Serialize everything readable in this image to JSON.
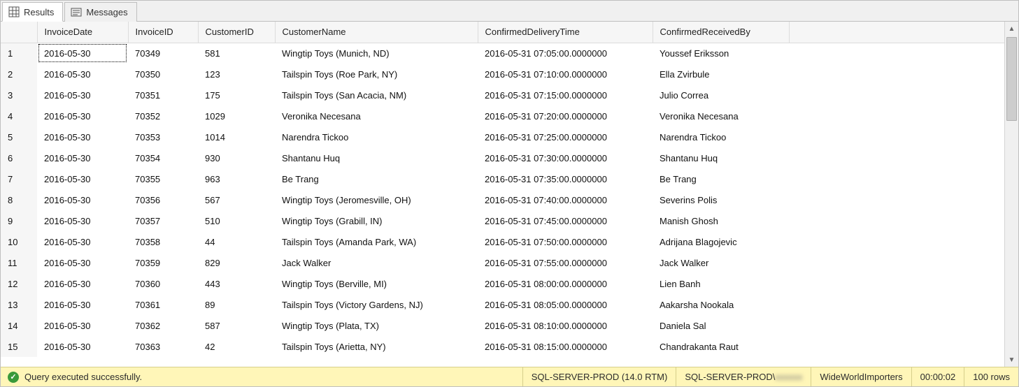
{
  "tabs": {
    "results": "Results",
    "messages": "Messages"
  },
  "columns": {
    "invoiceDate": "InvoiceDate",
    "invoiceId": "InvoiceID",
    "customerId": "CustomerID",
    "customerName": "CustomerName",
    "confirmedDeliveryTime": "ConfirmedDeliveryTime",
    "confirmedReceivedBy": "ConfirmedReceivedBy"
  },
  "rows": [
    {
      "n": "1",
      "invoiceDate": "2016-05-30",
      "invoiceId": "70349",
      "customerId": "581",
      "customerName": "Wingtip Toys (Munich, ND)",
      "confirmedDeliveryTime": "2016-05-31 07:05:00.0000000",
      "confirmedReceivedBy": "Youssef Eriksson"
    },
    {
      "n": "2",
      "invoiceDate": "2016-05-30",
      "invoiceId": "70350",
      "customerId": "123",
      "customerName": "Tailspin Toys (Roe Park, NY)",
      "confirmedDeliveryTime": "2016-05-31 07:10:00.0000000",
      "confirmedReceivedBy": "Ella Zvirbule"
    },
    {
      "n": "3",
      "invoiceDate": "2016-05-30",
      "invoiceId": "70351",
      "customerId": "175",
      "customerName": "Tailspin Toys (San Acacia, NM)",
      "confirmedDeliveryTime": "2016-05-31 07:15:00.0000000",
      "confirmedReceivedBy": "Julio Correa"
    },
    {
      "n": "4",
      "invoiceDate": "2016-05-30",
      "invoiceId": "70352",
      "customerId": "1029",
      "customerName": "Veronika Necesana",
      "confirmedDeliveryTime": "2016-05-31 07:20:00.0000000",
      "confirmedReceivedBy": "Veronika Necesana"
    },
    {
      "n": "5",
      "invoiceDate": "2016-05-30",
      "invoiceId": "70353",
      "customerId": "1014",
      "customerName": "Narendra Tickoo",
      "confirmedDeliveryTime": "2016-05-31 07:25:00.0000000",
      "confirmedReceivedBy": "Narendra Tickoo"
    },
    {
      "n": "6",
      "invoiceDate": "2016-05-30",
      "invoiceId": "70354",
      "customerId": "930",
      "customerName": "Shantanu Huq",
      "confirmedDeliveryTime": "2016-05-31 07:30:00.0000000",
      "confirmedReceivedBy": "Shantanu Huq"
    },
    {
      "n": "7",
      "invoiceDate": "2016-05-30",
      "invoiceId": "70355",
      "customerId": "963",
      "customerName": "Be Trang",
      "confirmedDeliveryTime": "2016-05-31 07:35:00.0000000",
      "confirmedReceivedBy": "Be Trang"
    },
    {
      "n": "8",
      "invoiceDate": "2016-05-30",
      "invoiceId": "70356",
      "customerId": "567",
      "customerName": "Wingtip Toys (Jeromesville, OH)",
      "confirmedDeliveryTime": "2016-05-31 07:40:00.0000000",
      "confirmedReceivedBy": "Severins Polis"
    },
    {
      "n": "9",
      "invoiceDate": "2016-05-30",
      "invoiceId": "70357",
      "customerId": "510",
      "customerName": "Wingtip Toys (Grabill, IN)",
      "confirmedDeliveryTime": "2016-05-31 07:45:00.0000000",
      "confirmedReceivedBy": "Manish Ghosh"
    },
    {
      "n": "10",
      "invoiceDate": "2016-05-30",
      "invoiceId": "70358",
      "customerId": "44",
      "customerName": "Tailspin Toys (Amanda Park, WA)",
      "confirmedDeliveryTime": "2016-05-31 07:50:00.0000000",
      "confirmedReceivedBy": "Adrijana Blagojevic"
    },
    {
      "n": "11",
      "invoiceDate": "2016-05-30",
      "invoiceId": "70359",
      "customerId": "829",
      "customerName": "Jack Walker",
      "confirmedDeliveryTime": "2016-05-31 07:55:00.0000000",
      "confirmedReceivedBy": "Jack Walker"
    },
    {
      "n": "12",
      "invoiceDate": "2016-05-30",
      "invoiceId": "70360",
      "customerId": "443",
      "customerName": "Wingtip Toys (Berville, MI)",
      "confirmedDeliveryTime": "2016-05-31 08:00:00.0000000",
      "confirmedReceivedBy": "Lien Banh"
    },
    {
      "n": "13",
      "invoiceDate": "2016-05-30",
      "invoiceId": "70361",
      "customerId": "89",
      "customerName": "Tailspin Toys (Victory Gardens, NJ)",
      "confirmedDeliveryTime": "2016-05-31 08:05:00.0000000",
      "confirmedReceivedBy": "Aakarsha Nookala"
    },
    {
      "n": "14",
      "invoiceDate": "2016-05-30",
      "invoiceId": "70362",
      "customerId": "587",
      "customerName": "Wingtip Toys (Plata, TX)",
      "confirmedDeliveryTime": "2016-05-31 08:10:00.0000000",
      "confirmedReceivedBy": "Daniela Sal"
    },
    {
      "n": "15",
      "invoiceDate": "2016-05-30",
      "invoiceId": "70363",
      "customerId": "42",
      "customerName": "Tailspin Toys (Arietta, NY)",
      "confirmedDeliveryTime": "2016-05-31 08:15:00.0000000",
      "confirmedReceivedBy": "Chandrakanta Raut"
    }
  ],
  "status": {
    "message": "Query executed successfully.",
    "server": "SQL-SERVER-PROD (14.0 RTM)",
    "login_prefix": "SQL-SERVER-PROD\\",
    "login_blur": "xxxxxx",
    "database": "WideWorldImporters",
    "elapsed": "00:00:02",
    "rowcount": "100 rows"
  }
}
